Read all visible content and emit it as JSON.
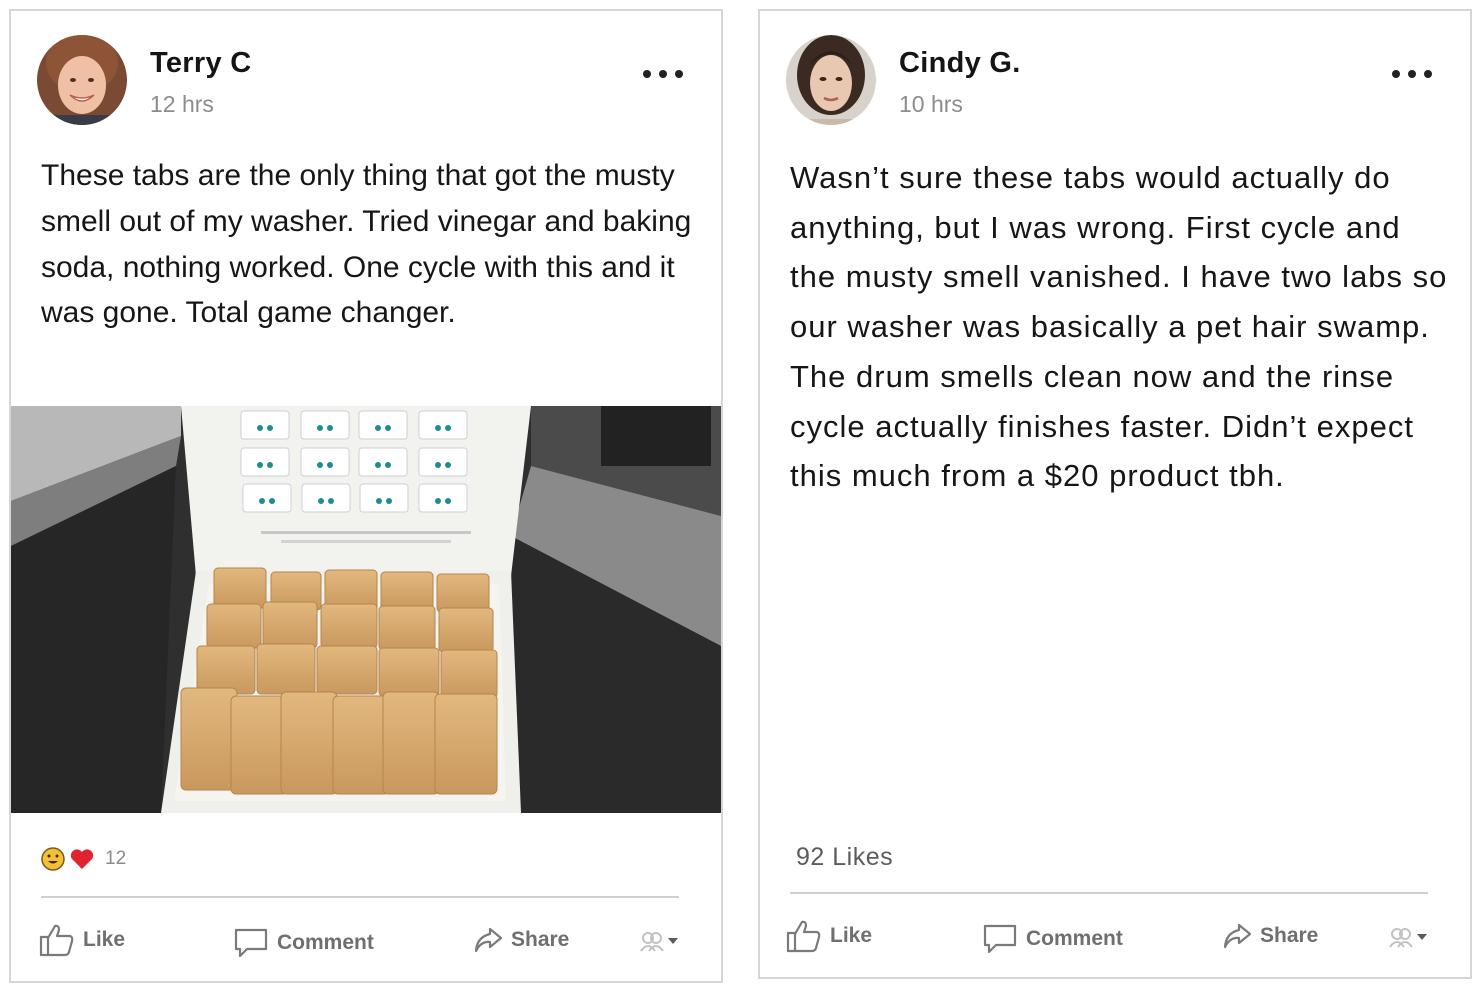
{
  "posts": [
    {
      "author": "Terry C",
      "time": "12 hrs",
      "text": "These tabs are the only thing that got the musty smell out of my washer. Tried vinegar and baking soda, nothing worked. One cycle with this and it was gone. Total game changer.",
      "reaction_count": "12",
      "actions": {
        "like": "Like",
        "comment": "Comment",
        "share": "Share"
      }
    },
    {
      "author": "Cindy G.",
      "time": "10 hrs",
      "text": "Wasn’t sure these tabs would actually do anything, but I was wrong. First cycle and the musty smell vanished. I have two labs so our washer was basically a pet hair swamp. The drum smells clean now and the rinse cycle actually finishes faster. Didn’t expect this much from a $20 product tbh.",
      "likes_text": "92 Likes",
      "actions": {
        "like": "Like",
        "comment": "Comment",
        "share": "Share"
      }
    }
  ],
  "colors": {
    "heart": "#e0242f",
    "emoji": "#f4c03a",
    "icon_gray": "#7a7a7a"
  },
  "icons": [
    "more-dots-icon",
    "thumbs-up-icon",
    "comment-bubble-icon",
    "share-arrow-icon",
    "audience-icon",
    "caret-down-icon"
  ]
}
